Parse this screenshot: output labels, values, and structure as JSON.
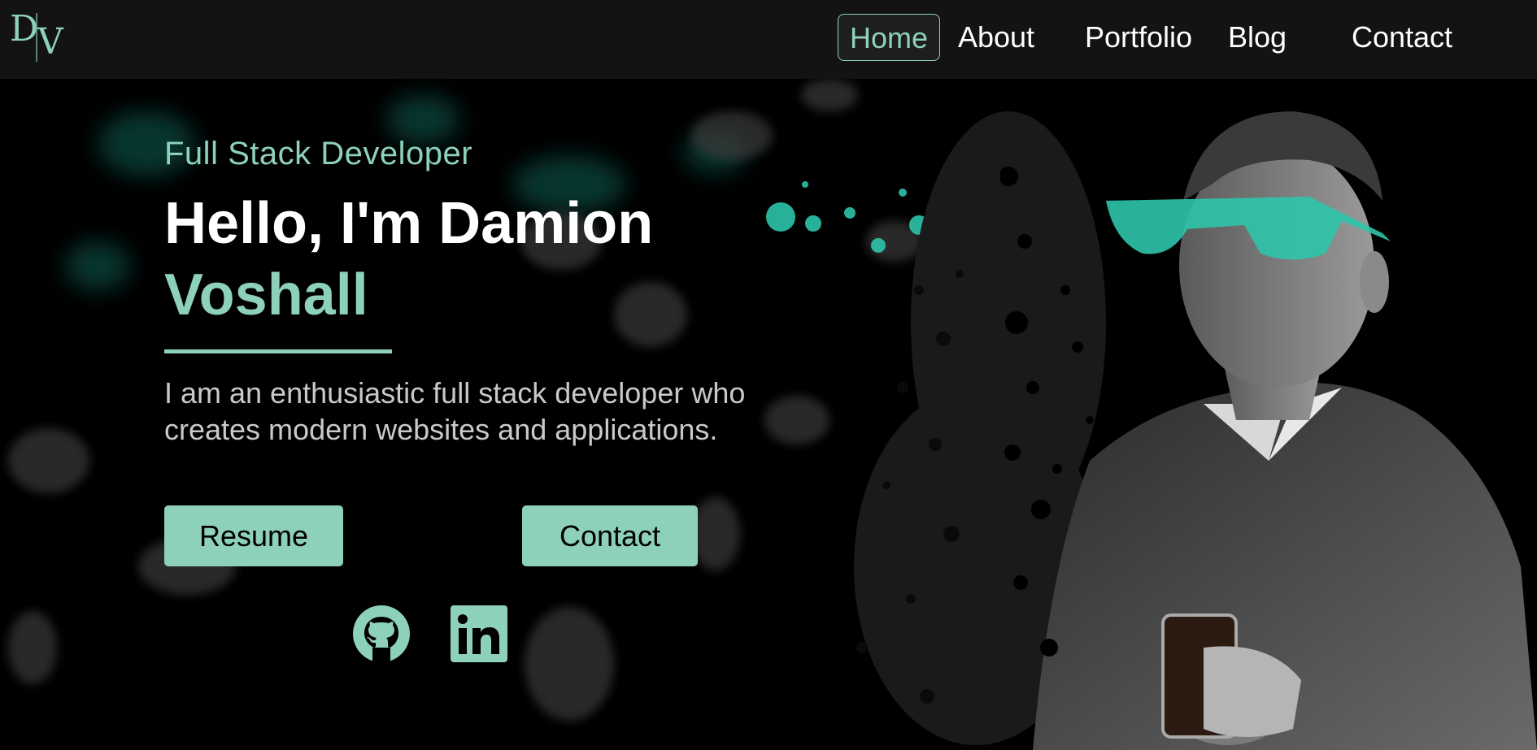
{
  "nav": {
    "logo_alt": "DV",
    "items": [
      {
        "label": "Home",
        "active": true
      },
      {
        "label": "About",
        "active": false
      },
      {
        "label": "Portfolio",
        "active": false
      },
      {
        "label": "Blog",
        "active": false
      },
      {
        "label": "Contact",
        "active": false
      }
    ]
  },
  "hero": {
    "subtitle": "Full Stack Developer",
    "greeting": "Hello, I'm Damion",
    "surname": "Voshall",
    "bio": "I am an enthusiastic full stack developer who creates modern websites and applications.",
    "buttons": {
      "resume": "Resume",
      "contact": "Contact"
    },
    "social": {
      "github": "github-icon",
      "linkedin": "linkedin-icon"
    }
  },
  "colors": {
    "accent": "#8ed1bb",
    "nav_bg": "#131313",
    "page_bg": "#000000",
    "glasses": "#2ec4aa"
  }
}
